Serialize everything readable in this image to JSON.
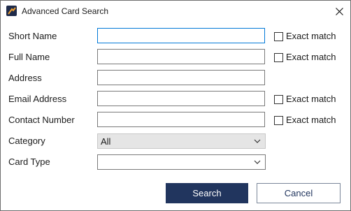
{
  "window": {
    "title": "Advanced Card Search",
    "icon": "app-logo-icon",
    "close_icon": "close-icon"
  },
  "form": {
    "short_name": {
      "label": "Short Name",
      "value": "",
      "exact_match_label": "Exact match",
      "exact_match_checked": false
    },
    "full_name": {
      "label": "Full Name",
      "value": "",
      "exact_match_label": "Exact match",
      "exact_match_checked": false
    },
    "address": {
      "label": "Address",
      "value": ""
    },
    "email_address": {
      "label": "Email Address",
      "value": "",
      "exact_match_label": "Exact match",
      "exact_match_checked": false
    },
    "contact_number": {
      "label": "Contact Number",
      "value": "",
      "exact_match_label": "Exact match",
      "exact_match_checked": false
    },
    "category": {
      "label": "Category",
      "selected": "All"
    },
    "card_type": {
      "label": "Card Type",
      "selected": ""
    }
  },
  "buttons": {
    "search_label": "Search",
    "cancel_label": "Cancel"
  },
  "colors": {
    "primary": "#21355e",
    "focus_border": "#0078d7"
  }
}
